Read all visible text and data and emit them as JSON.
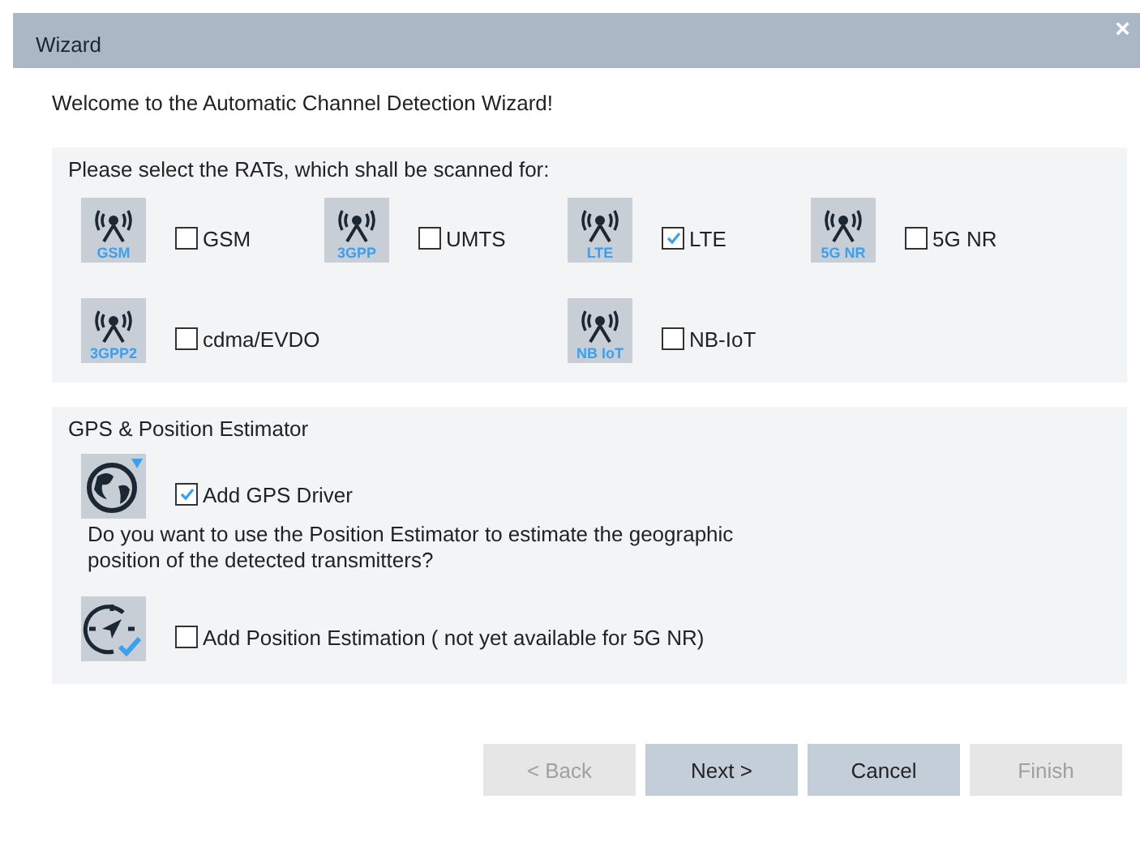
{
  "window": {
    "title": "Wizard",
    "close": "×"
  },
  "welcome": "Welcome to the Automatic Channel Detection Wizard!",
  "rat_panel": {
    "heading": "Please select the RATs, which shall be scanned for:",
    "rows": [
      [
        {
          "badge": "GSM",
          "label": "GSM",
          "checked": false
        },
        {
          "badge": "3GPP",
          "label": "UMTS",
          "checked": false
        },
        {
          "badge": "LTE",
          "label": "LTE",
          "checked": true
        },
        {
          "badge": "5G NR",
          "label": "5G NR",
          "checked": false
        }
      ],
      [
        {
          "badge": "3GPP2",
          "label": "cdma/EVDO",
          "checked": false
        },
        "",
        {
          "badge": "NB IoT",
          "label": "NB-IoT",
          "checked": false
        }
      ]
    ]
  },
  "gps_panel": {
    "heading": "GPS & Position Estimator",
    "gps_driver": {
      "label": "Add GPS Driver",
      "checked": true
    },
    "question": "Do you want to use the Position Estimator to estimate the geographic position of the detected transmitters?",
    "position_estimation": {
      "label": "Add Position Estimation ( not yet available for 5G NR)",
      "checked": false
    }
  },
  "buttons": [
    {
      "label": "< Back",
      "disabled": true
    },
    {
      "label": "Next >",
      "disabled": false
    },
    {
      "label": "Cancel",
      "disabled": false
    },
    {
      "label": "Finish",
      "disabled": true
    }
  ]
}
